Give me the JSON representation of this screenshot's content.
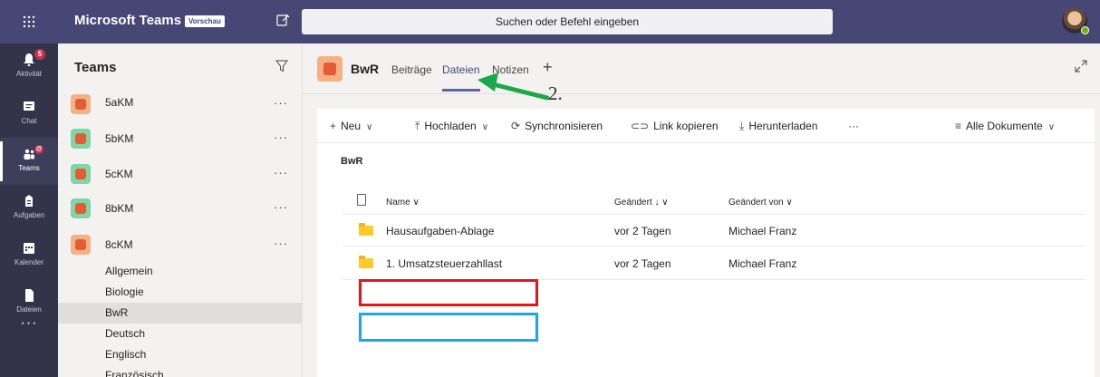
{
  "topbar": {
    "app_title": "Microsoft Teams",
    "preview_badge": "Vorschau",
    "search_placeholder": "Suchen oder Befehl eingeben",
    "bg_color": "#464775"
  },
  "rail": {
    "items": [
      {
        "label": "Aktivität",
        "icon": "bell-icon",
        "badge": "5"
      },
      {
        "label": "Chat",
        "icon": "chat-icon"
      },
      {
        "label": "Teams",
        "icon": "teams-icon",
        "badge": "@",
        "active": true
      },
      {
        "label": "Aufgaben",
        "icon": "assignments-icon"
      },
      {
        "label": "Kalender",
        "icon": "calendar-icon"
      },
      {
        "label": "Dateien",
        "icon": "files-icon"
      }
    ],
    "more": "···"
  },
  "teams_panel": {
    "header": "Teams",
    "teams": [
      {
        "name": "5aKM",
        "tile_color": "#f4b183"
      },
      {
        "name": "5bKM",
        "tile_color": "#7fd4a8"
      },
      {
        "name": "5cKM",
        "tile_color": "#7fd4a8"
      },
      {
        "name": "8bKM",
        "tile_color": "#7fd4a8"
      },
      {
        "name": "8cKM",
        "tile_color": "#f4b183"
      }
    ],
    "more": "···",
    "channels": [
      "Allgemein",
      "Biologie",
      "BwR",
      "Deutsch",
      "Englisch",
      "Französisch"
    ],
    "active_channel": "BwR"
  },
  "channel": {
    "name": "BwR",
    "tabs": [
      "Beiträge",
      "Dateien",
      "Notizen"
    ],
    "active_tab": "Dateien",
    "add_tab": "+"
  },
  "toolbar": {
    "new": "Neu",
    "upload": "Hochladen",
    "sync": "Synchronisieren",
    "copy_link": "Link kopieren",
    "download": "Herunterladen",
    "more": "···",
    "view": "Alle Dokumente"
  },
  "library": {
    "title": "BwR",
    "columns": {
      "name": "Name",
      "modified": "Geändert ↓",
      "modified_by": "Geändert von"
    },
    "rows": [
      {
        "name": "Hausaufgaben-Ablage",
        "modified": "vor 2 Tagen",
        "modified_by": "Michael Franz",
        "type": "folder"
      },
      {
        "name": "1. Umsatzsteuerzahllast",
        "modified": "vor 2 Tagen",
        "modified_by": "Michael Franz",
        "type": "folder"
      }
    ]
  },
  "annotation": {
    "label": "2.",
    "arrow_color": "#1aa84a",
    "highlight_red": "#e8131b",
    "highlight_blue": "#1ba8e8"
  }
}
